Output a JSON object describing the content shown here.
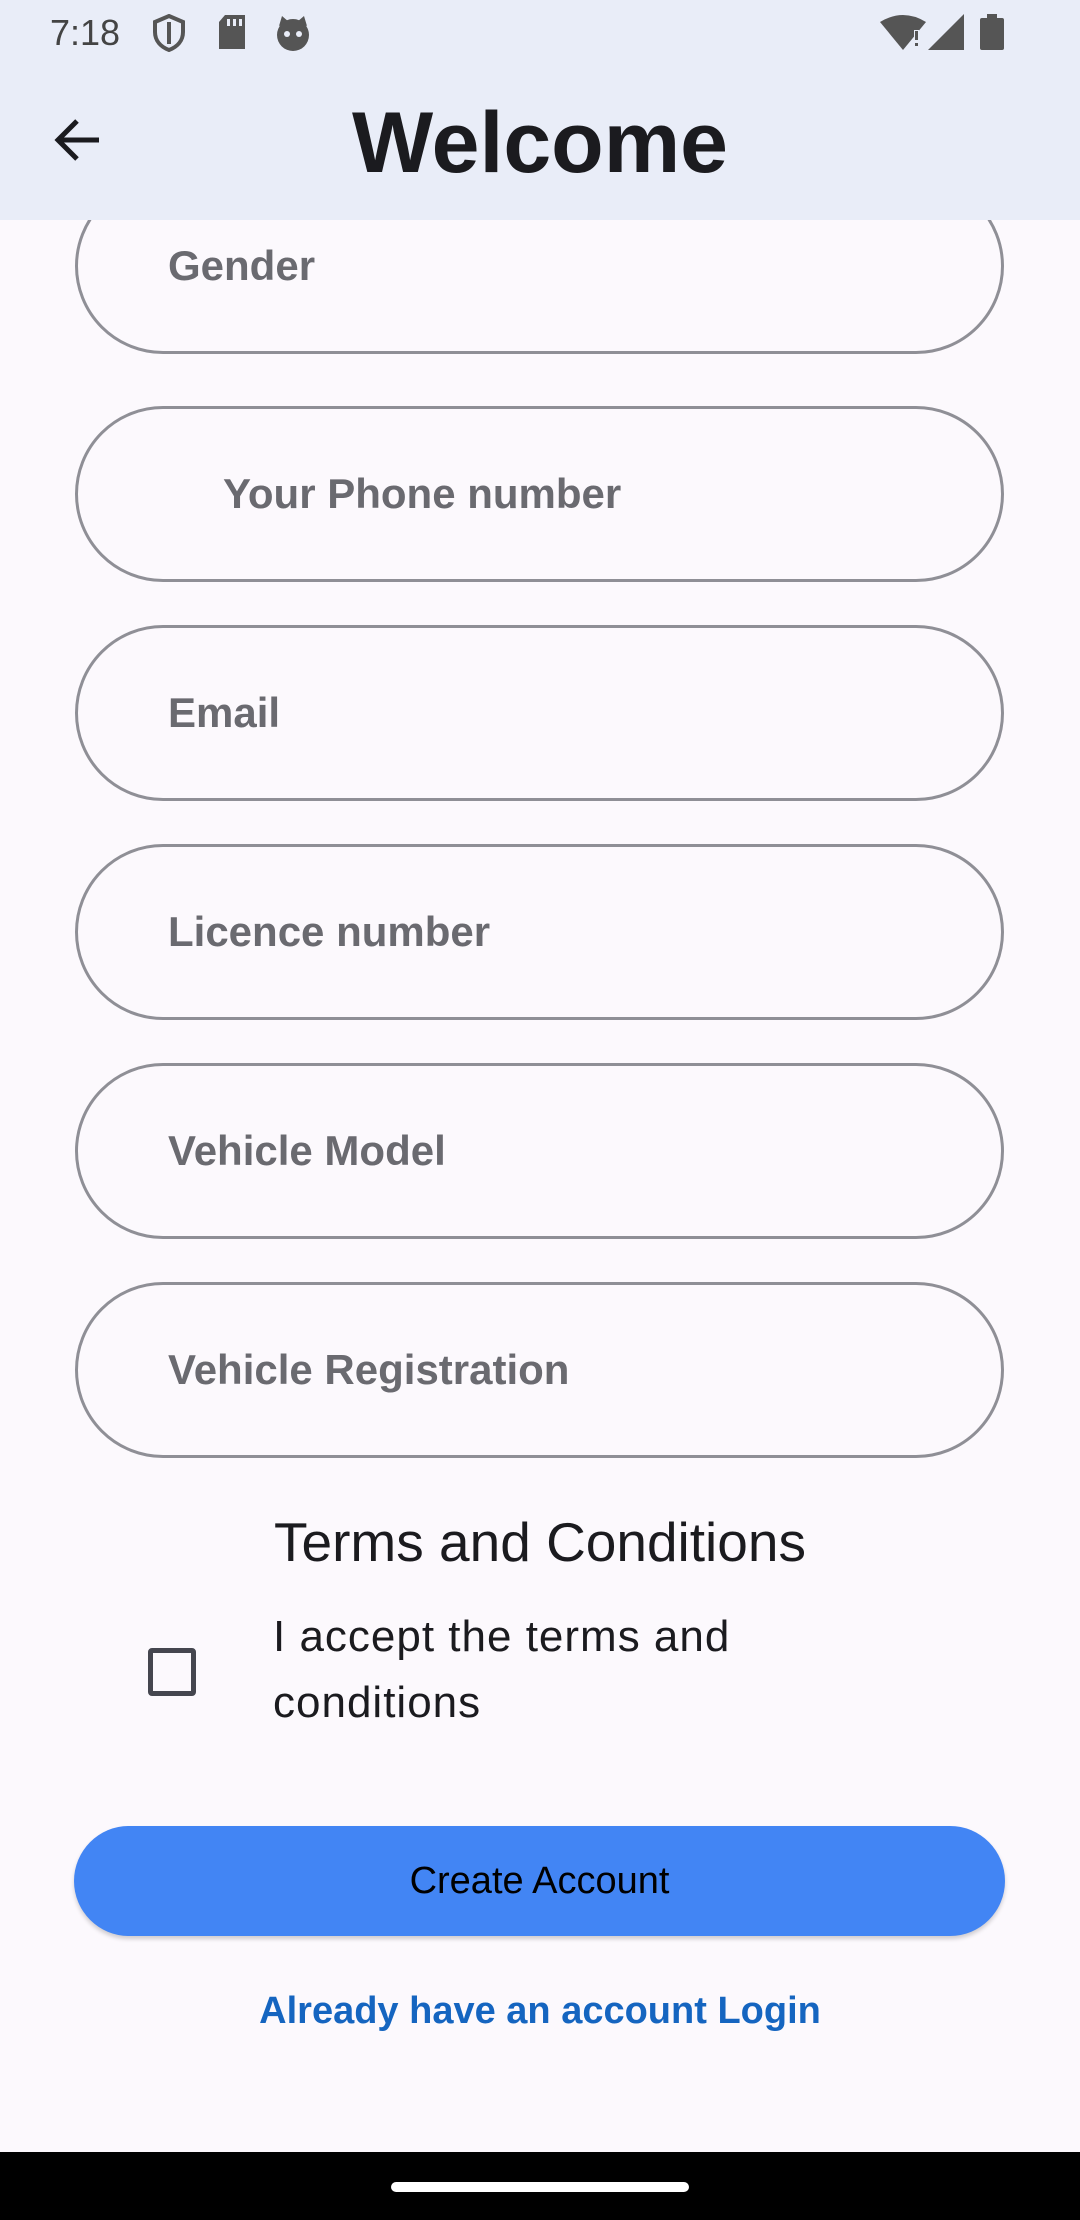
{
  "status_bar": {
    "time": "7:18",
    "left_icons": [
      "shield-icon",
      "sd-card-icon",
      "cat-face-icon"
    ],
    "right_icons": [
      "wifi-alert-icon",
      "signal-icon",
      "battery-icon"
    ]
  },
  "app_bar": {
    "back_icon": "arrow-back-icon",
    "title": "Welcome"
  },
  "form": {
    "fields": [
      {
        "label": "Gender"
      },
      {
        "label": "Your Phone number"
      },
      {
        "label": "Email"
      },
      {
        "label": "Licence number"
      },
      {
        "label": "Vehicle Model"
      },
      {
        "label": "Vehicle Registration"
      }
    ],
    "terms_title": "Terms and Conditions",
    "accept_label": "I accept the terms and conditions",
    "accept_checked": false,
    "create_button": "Create Account",
    "login_link": "Already have an account Login"
  },
  "colors": {
    "accent": "#4285f4",
    "link": "#1565c0",
    "app_bar": "#e9edf8",
    "background": "#fcf9fd"
  }
}
